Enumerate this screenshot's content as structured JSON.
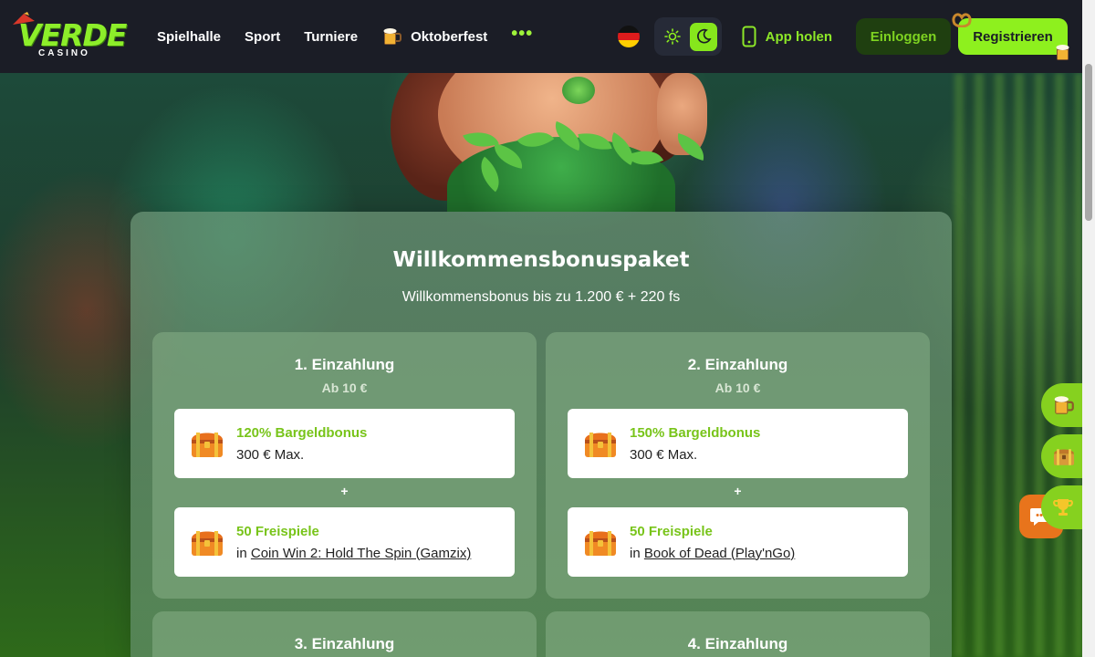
{
  "header": {
    "logo_text": "VERDE",
    "logo_sub": "CASINO",
    "nav": [
      {
        "label": "Spielhalle"
      },
      {
        "label": "Sport"
      },
      {
        "label": "Turniere"
      },
      {
        "label": "Oktoberfest",
        "icon": "beer-mug-icon"
      }
    ],
    "more_label": "•••",
    "language": "de",
    "theme": "dark",
    "app_label": "App holen",
    "login_label": "Einloggen",
    "register_label": "Registrieren"
  },
  "bonus": {
    "title": "Willkommensbonuspaket",
    "subtitle": "Willkommensbonus bis zu 1.200 € + 220 fs",
    "deposits": [
      {
        "title": "1. Einzahlung",
        "min": "Ab 10 €",
        "cash_title": "120% Bargeldbonus",
        "cash_max": "300 € Max.",
        "spins_title": "50 Freispiele",
        "spins_prefix": "in",
        "spins_game": "Coin Win 2: Hold The Spin (Gamzix)"
      },
      {
        "title": "2. Einzahlung",
        "min": "Ab 10 €",
        "cash_title": "150% Bargeldbonus",
        "cash_max": "300 € Max.",
        "spins_title": "50 Freispiele",
        "spins_prefix": "in",
        "spins_game": "Book of Dead (Play'nGo)"
      },
      {
        "title": "3. Einzahlung"
      },
      {
        "title": "4. Einzahlung"
      }
    ],
    "plus": "+"
  },
  "colors": {
    "accent": "#8ef01e",
    "header_bg": "#1b1d26",
    "bonus_text": "#78c41a",
    "chat": "#e8741c"
  }
}
